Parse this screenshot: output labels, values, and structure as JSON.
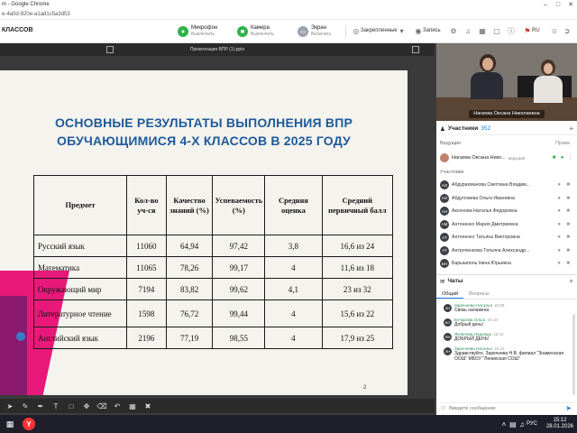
{
  "browser": {
    "title": "m - Google Chrome",
    "url": "e-4a0d-920e-a1ad1c5a3d53"
  },
  "meeting": {
    "title": "КЛАССОВ",
    "mic": {
      "label": "Микрофон",
      "status": "Выключить"
    },
    "camera": {
      "label": "Камера",
      "status": "Выключить"
    },
    "screen": {
      "label": "Экран",
      "status": "Включить"
    },
    "pinned_label": "Закрепленные",
    "record_label": "Запись",
    "lang": "RU"
  },
  "presentation": {
    "title": "Презентация ВПР (1).pptx",
    "slide_title_line1": "ОСНОВНЫЕ РЕЗУЛЬТАТЫ ВЫПОЛНЕНИЯ ВПР",
    "slide_title_line2": "ОБУЧАЮЩИМИСЯ 4-Х КЛАССОВ В 2025 ГОДУ",
    "page_number": "2",
    "table": {
      "headers": [
        "Предмет",
        "Кол-во уч-ся",
        "Качество знаний (%)",
        "Успеваемость (%)",
        "Средняя оценка",
        "Средний первичный балл"
      ],
      "rows": [
        [
          "Русский язык",
          "11060",
          "64,94",
          "97,42",
          "3,8",
          "16,6 из 24"
        ],
        [
          "Математика",
          "11065",
          "78,26",
          "99,17",
          "4",
          "11,6 из 18"
        ],
        [
          "Окружающий мир",
          "7194",
          "83,82",
          "99,62",
          "4,1",
          "23 из 32"
        ],
        [
          "Литературное чтение",
          "1598",
          "76,72",
          "99,44",
          "4",
          "15,6 из 22"
        ],
        [
          "Английский язык",
          "2196",
          "77,19",
          "98,55",
          "4",
          "17,9 из 25"
        ]
      ]
    }
  },
  "video": {
    "name": "Нагаева Оксана Николаевна"
  },
  "participants": {
    "title": "Участники",
    "count": "352",
    "hosts_label": "Ведущие",
    "rights_label": "Права",
    "host": {
      "name": "Нагаева Оксана Нико...",
      "role": "ведущий"
    },
    "members_label": "Участники",
    "list": [
      {
        "initials": "АО",
        "name": "Абдурахманова Светлана Владим..."
      },
      {
        "initials": "АО",
        "name": "Абдуллаева Ольга Ивановна"
      },
      {
        "initials": "АН",
        "name": "Аксенова Наталья Федоровна"
      },
      {
        "initials": "АМ",
        "name": "Антоненко Мария Дмитриевна"
      },
      {
        "initials": "АТ",
        "name": "Антоненко Татьяна Викторовна"
      },
      {
        "initials": "АТ",
        "name": "Антропенкова Татьяна Александр..."
      },
      {
        "initials": "БН",
        "name": "Барышполь Нина Юрьевна"
      }
    ]
  },
  "chat": {
    "title": "Чаты",
    "tabs": [
      "Общий",
      "Вопросы"
    ],
    "messages": [
      {
        "initials": "ЗН",
        "author": "Заречнева Наталья",
        "time": "15:09",
        "text": "Связь налажена"
      },
      {
        "initials": "БО",
        "author": "Бочарова Ольга",
        "time": "15:10",
        "text": "Добрый день!"
      },
      {
        "initials": "ЯН",
        "author": "Яковлева Надежда",
        "time": "15:10",
        "text": "ДОБРЫЙ ДЕНЬ!"
      },
      {
        "initials": "ЗН",
        "author": "Заречнева Наталья",
        "time": "15:10",
        "text": "Здравствуйте. Заречнева Н.В. филиал \"Знаменская ООШ\" МБОУ \"Ленинская СОШ\""
      }
    ],
    "input_placeholder": "Введите сообщение"
  },
  "taskbar": {
    "lang": "РУС",
    "time": "15:12",
    "date": "28.01.2026"
  }
}
